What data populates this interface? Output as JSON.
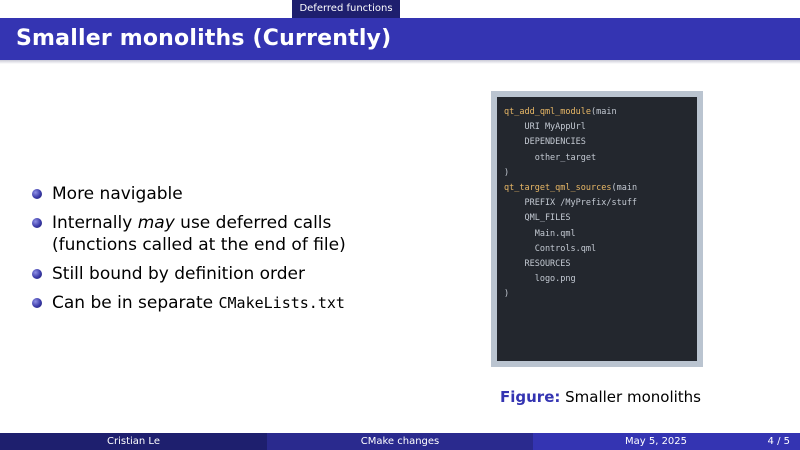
{
  "header": {
    "section": "Deferred functions"
  },
  "slide": {
    "title": "Smaller monoliths (Currently)"
  },
  "bullets": {
    "item1": "More navigable",
    "item2_pre": "Internally ",
    "item2_em": "may",
    "item2_post": " use deferred calls",
    "item2_line2": "(functions called at the end of file)",
    "item3": "Still bound by definition order",
    "item4_pre": "Can be in separate ",
    "item4_code": "CMakeLists.txt"
  },
  "code": {
    "l1_fn": "qt_add_qml_module",
    "l1_rest": "(main",
    "l2": "    URI MyAppUrl",
    "l3": "    DEPENDENCIES",
    "l4": "      other_target",
    "l5": ")",
    "l6_fn": "qt_target_qml_sources",
    "l6_rest": "(main",
    "l7": "    PREFIX /MyPrefix/stuff",
    "l8": "    QML_FILES",
    "l9": "      Main.qml",
    "l10": "      Controls.qml",
    "l11": "    RESOURCES",
    "l12": "      logo.png",
    "l13": ")"
  },
  "figure": {
    "label": "Figure:",
    "caption": " Smaller monoliths"
  },
  "footer": {
    "author": "Cristian Le",
    "title": "CMake changes",
    "date": "May 5, 2025",
    "page": "4 / 5"
  },
  "colors": {
    "title_bar": "#3434b2",
    "dark_bar": "#1e1f6e",
    "code_bg": "#23272e",
    "code_keyword": "#e9b866"
  }
}
